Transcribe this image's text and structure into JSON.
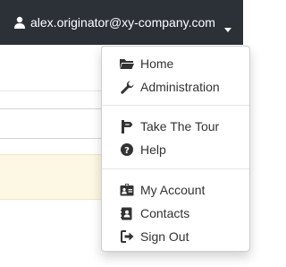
{
  "navbar": {
    "user_email": "alex.originator@xy-company.com",
    "background": "#2c3138",
    "user_icon": "user-icon",
    "caret_icon": "caret-down-icon"
  },
  "dropdown": {
    "groups": [
      {
        "items": [
          {
            "label": "Home",
            "icon": "folder-open-icon"
          },
          {
            "label": "Administration",
            "icon": "wrench-icon"
          }
        ]
      },
      {
        "items": [
          {
            "label": "Take The Tour",
            "icon": "signpost-icon"
          },
          {
            "label": "Help",
            "icon": "question-circle-icon"
          }
        ]
      },
      {
        "items": [
          {
            "label": "My Account",
            "icon": "id-card-icon"
          },
          {
            "label": "Contacts",
            "icon": "address-book-icon"
          },
          {
            "label": "Sign Out",
            "icon": "sign-out-icon"
          }
        ]
      }
    ]
  },
  "colors": {
    "menu_text": "#333333",
    "alert_background": "#fcf8e3"
  }
}
